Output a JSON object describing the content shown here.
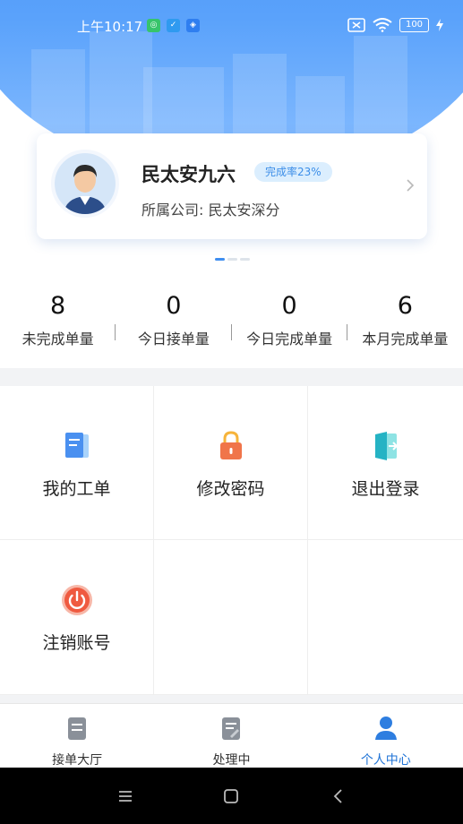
{
  "status_bar": {
    "time": "上午10:17",
    "battery": "100"
  },
  "profile": {
    "name": "民太安九六",
    "completion_badge": "完成率23%",
    "company": "所属公司: 民太安深分"
  },
  "stats": [
    {
      "value": "8",
      "label": "未完成单量"
    },
    {
      "value": "0",
      "label": "今日接单量"
    },
    {
      "value": "0",
      "label": "今日完成单量"
    },
    {
      "value": "6",
      "label": "本月完成单量"
    }
  ],
  "menu": [
    {
      "label": "我的工单",
      "icon": "document-icon"
    },
    {
      "label": "修改密码",
      "icon": "lock-icon"
    },
    {
      "label": "退出登录",
      "icon": "logout-door-icon"
    },
    {
      "label": "注销账号",
      "icon": "power-icon"
    }
  ],
  "tabs": [
    {
      "label": "接单大厅",
      "icon": "order-list-icon",
      "active": false
    },
    {
      "label": "处理中",
      "icon": "processing-doc-icon",
      "active": false
    },
    {
      "label": "个人中心",
      "icon": "user-icon",
      "active": true
    }
  ],
  "colors": {
    "primary": "#3d8bf5",
    "active_tab": "#1f73d6",
    "badge_bg": "#dbeefe",
    "badge_text": "#3c8ee8",
    "lock": "#f0754a",
    "power": "#ef5a40"
  }
}
